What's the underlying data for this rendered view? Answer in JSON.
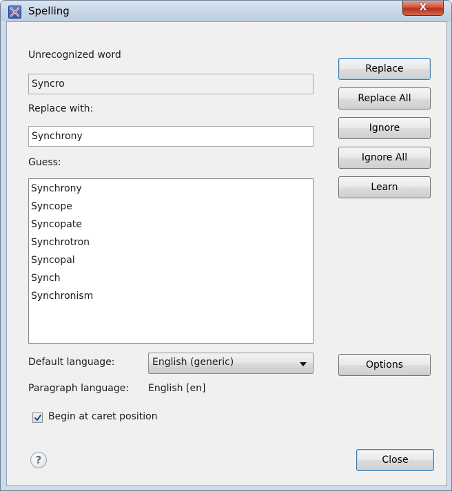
{
  "window": {
    "title": "Spelling",
    "close_glyph": "X"
  },
  "unrecognized": {
    "label": "Unrecognized word",
    "value": "Syncro"
  },
  "replace_with": {
    "label": "Replace with:",
    "value": "Synchrony"
  },
  "guess": {
    "label": "Guess:",
    "items": [
      "Synchrony",
      "Syncope",
      "Syncopate",
      "Synchrotron",
      "Syncopal",
      "Synch",
      "Synchronism"
    ]
  },
  "buttons": {
    "replace": "Replace",
    "replace_all": "Replace All",
    "ignore": "Ignore",
    "ignore_all": "Ignore All",
    "learn": "Learn",
    "options": "Options",
    "close": "Close"
  },
  "default_language": {
    "label": "Default language:",
    "selected": "English (generic)"
  },
  "paragraph_language": {
    "label": "Paragraph language:",
    "value": "English [en]"
  },
  "begin_at_caret": {
    "label": "Begin at caret position",
    "checked": true
  },
  "help": {
    "glyph": "?"
  },
  "icons": {
    "app": "app-logo-icon",
    "close": "close-icon",
    "dropdown": "chevron-down-icon",
    "help": "help-icon",
    "check": "check-icon"
  },
  "colors": {
    "title_bar": "#c9d7e6",
    "close_button": "#c8442c",
    "dialog_bg": "#f0f0f0",
    "default_button_border": "#3c7fb1"
  }
}
